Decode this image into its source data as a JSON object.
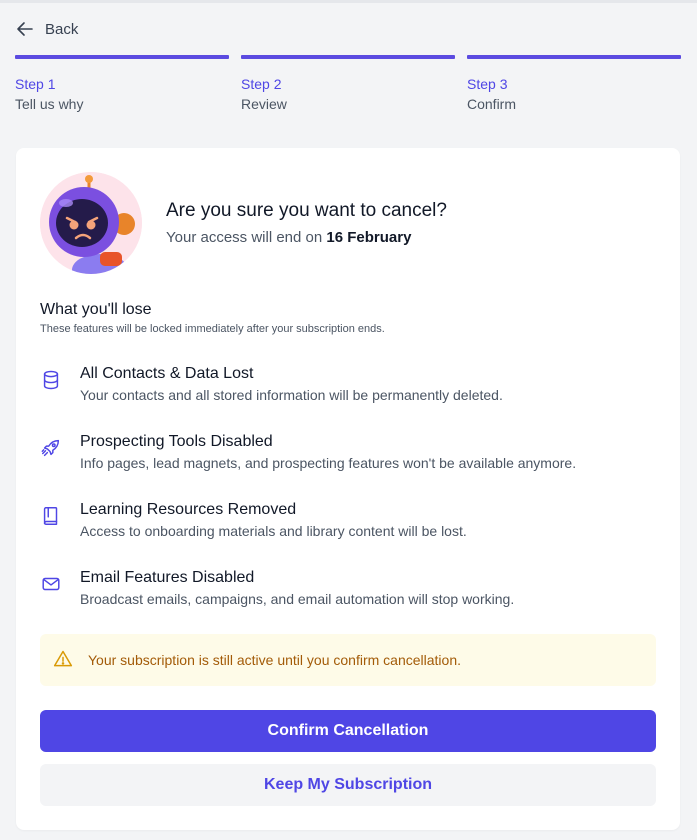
{
  "nav": {
    "back_label": "Back"
  },
  "steps": [
    {
      "number": "Step 1",
      "name": "Tell us why"
    },
    {
      "number": "Step 2",
      "name": "Review"
    },
    {
      "number": "Step 3",
      "name": "Confirm"
    }
  ],
  "header": {
    "title": "Are you sure you want to cancel?",
    "subtitle_prefix": "Your access will end on ",
    "end_date": "16 February"
  },
  "lose": {
    "title": "What you'll lose",
    "subtitle": "These features will be locked immediately after your subscription ends."
  },
  "features": [
    {
      "icon": "database-icon",
      "title": "All Contacts & Data Lost",
      "description": "Your contacts and all stored information will be permanently deleted."
    },
    {
      "icon": "rocket-icon",
      "title": "Prospecting Tools Disabled",
      "description": "Info pages, lead magnets, and prospecting features won't be available anymore."
    },
    {
      "icon": "book-icon",
      "title": "Learning Resources Removed",
      "description": "Access to onboarding materials and library content will be lost."
    },
    {
      "icon": "mail-icon",
      "title": "Email Features Disabled",
      "description": "Broadcast emails, campaigns, and email automation will stop working."
    }
  ],
  "notice": {
    "text": "Your subscription is still active until you confirm cancellation."
  },
  "actions": {
    "confirm_label": "Confirm Cancellation",
    "keep_label": "Keep My Subscription"
  },
  "colors": {
    "accent": "#4f46e5",
    "step_bar": "#5b4be0",
    "warning_bg": "#fefbe8",
    "warning_text": "#a35b08"
  }
}
